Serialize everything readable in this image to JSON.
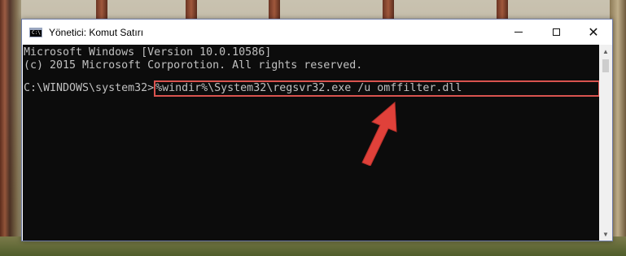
{
  "window": {
    "title": "Yönetici: Komut Satırı",
    "icon": "cmd-icon",
    "icon_glyph": "C:\\"
  },
  "controls": {
    "minimize": "minimize-icon",
    "maximize": "maximize-icon",
    "close": "close-icon",
    "close_glyph": "✕"
  },
  "console": {
    "lines": [
      "Microsoft Windows [Version 10.0.10586]",
      "(c) 2015 Microsoft Corporotion. All rights reserved."
    ],
    "prompt": "C:\\WINDOWS\\system32>",
    "command": "%windir%\\System32\\regsvr32.exe /u omffilter.dll"
  },
  "annotation": {
    "highlight_color": "#d9534f",
    "arrow_color": "#e0413a"
  },
  "scrollbar": {
    "up": "▲",
    "down": "▼"
  }
}
